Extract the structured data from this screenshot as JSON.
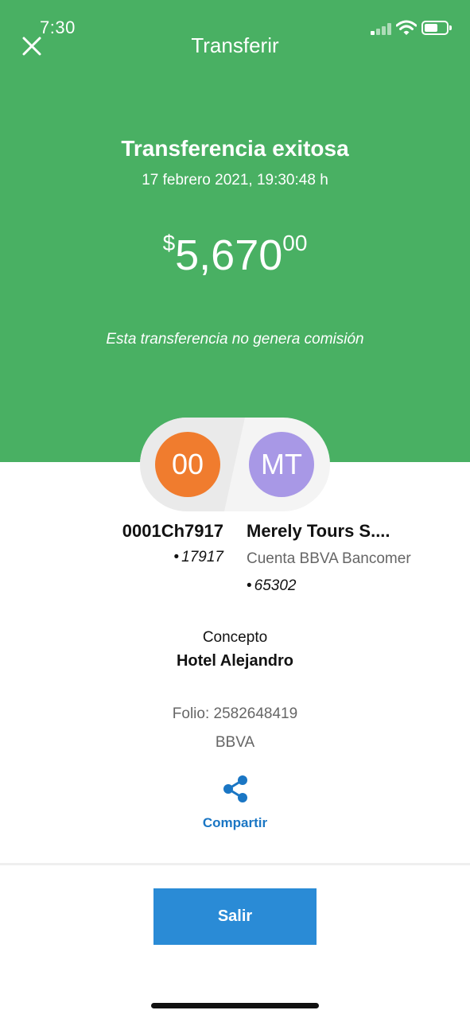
{
  "status_bar": {
    "time": "7:30",
    "signal_bars_active": 1,
    "battery_level": 0.6,
    "icons": [
      "signal-icon",
      "wifi-icon",
      "battery-icon"
    ]
  },
  "nav": {
    "close_icon": "close-icon",
    "title": "Transferir"
  },
  "result": {
    "title": "Transferencia exitosa",
    "date": "17 febrero 2021, 19:30:48 h",
    "amount": {
      "currency": "$",
      "integer": "5,670",
      "decimals": "00"
    },
    "commission_note": "Esta transferencia no genera comisión"
  },
  "sender": {
    "initials": "00",
    "name": "0001Ch7917",
    "account": "17917",
    "color": "#F07C2E"
  },
  "recipient": {
    "initials": "MT",
    "name": "Merely Tours S....",
    "bank": "Cuenta BBVA Bancomer",
    "account": "65302",
    "color": "#A898E6"
  },
  "details": {
    "concept_label": "Concepto",
    "concept_value": "Hotel Alejandro",
    "folio": "Folio: 2582648419",
    "bank": "BBVA"
  },
  "share": {
    "icon": "share-icon",
    "label": "Compartir"
  },
  "footer": {
    "exit_label": "Salir"
  },
  "colors": {
    "header_green": "#49B063",
    "primary_blue": "#2A8BD6",
    "link_blue": "#1A76C4"
  }
}
